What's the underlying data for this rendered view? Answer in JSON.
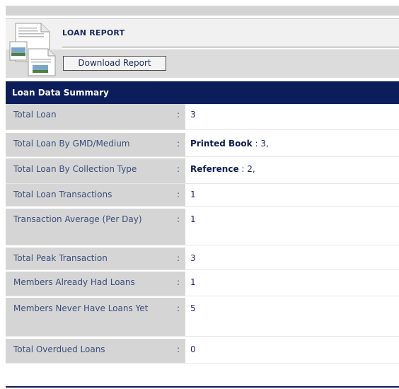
{
  "header": {
    "title": "LOAN REPORT",
    "download_label": "Download Report",
    "icon": "document-report-icon"
  },
  "section": {
    "title": "Loan Data Summary"
  },
  "summary": {
    "separator": ":",
    "rows": [
      {
        "label": "Total Loan",
        "value": "3"
      },
      {
        "label": "Total Loan By GMD/Medium",
        "bold": "Printed Book",
        "suffix": " : 3,"
      },
      {
        "label": "Total Loan By Collection Type",
        "bold": "Reference",
        "suffix": " : 2,"
      },
      {
        "label": "Total Loan Transactions",
        "value": "1"
      },
      {
        "label": "Transaction Average (Per Day)",
        "value": "1"
      },
      {
        "label": "Total Peak Transaction",
        "value": "3"
      },
      {
        "label": "Members Already Had Loans",
        "value": "1"
      },
      {
        "label": "Members Never Have Loans Yet",
        "value": "5"
      },
      {
        "label": "Total Overdued Loans",
        "value": "0"
      }
    ]
  },
  "colors": {
    "heading_bg": "#0b1d5a",
    "label_bg": "#d5d5d5",
    "text": "#1b2a5c"
  }
}
